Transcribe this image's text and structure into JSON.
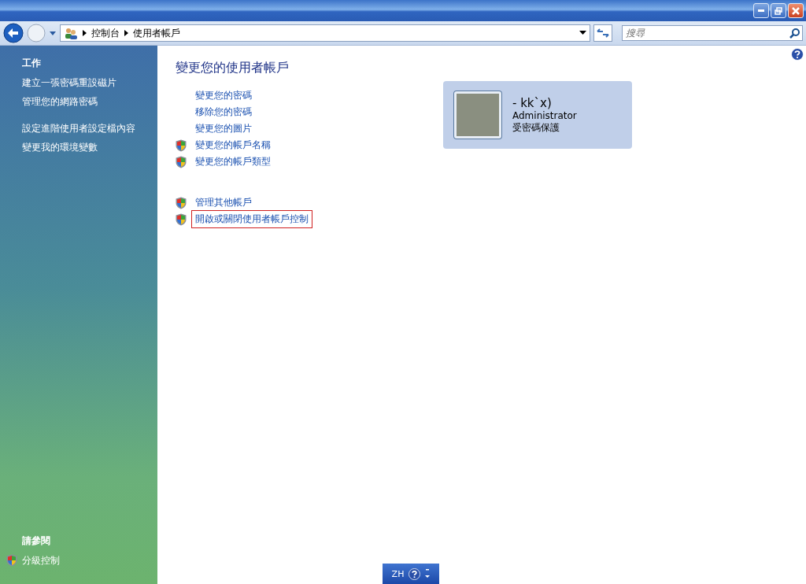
{
  "address_bar": {
    "breadcrumbs": [
      "控制台",
      "使用者帳戶"
    ]
  },
  "search": {
    "placeholder": "搜尋"
  },
  "sidebar": {
    "tasks_heading": "工作",
    "task_groups": [
      [
        {
          "label": "建立一張密碼重設磁片"
        },
        {
          "label": "管理您的網路密碼"
        }
      ],
      [
        {
          "label": "設定進階使用者設定檔內容"
        },
        {
          "label": "變更我的環境變數"
        }
      ]
    ],
    "see_also_heading": "請參閱",
    "see_also": [
      {
        "label": "分級控制",
        "kind": "shield"
      }
    ]
  },
  "main": {
    "title": "變更您的使用者帳戶",
    "link_groups": [
      [
        {
          "label": "變更您的密碼",
          "kind": "plain",
          "highlighted": false
        },
        {
          "label": "移除您的密碼",
          "kind": "plain",
          "highlighted": false
        },
        {
          "label": "變更您的圖片",
          "kind": "plain",
          "highlighted": false
        },
        {
          "label": "變更您的帳戶名稱",
          "kind": "shield",
          "highlighted": false
        },
        {
          "label": "變更您的帳戶類型",
          "kind": "shield",
          "highlighted": false
        }
      ],
      [
        {
          "label": "管理其他帳戶",
          "kind": "shield",
          "highlighted": false
        },
        {
          "label": "開啟或關閉使用者帳戶控制",
          "kind": "shield",
          "highlighted": true
        }
      ]
    ]
  },
  "account": {
    "name": "- kk`x)",
    "type": "Administrator",
    "status": "受密碼保護"
  },
  "language_bar": {
    "language": "ZH"
  }
}
